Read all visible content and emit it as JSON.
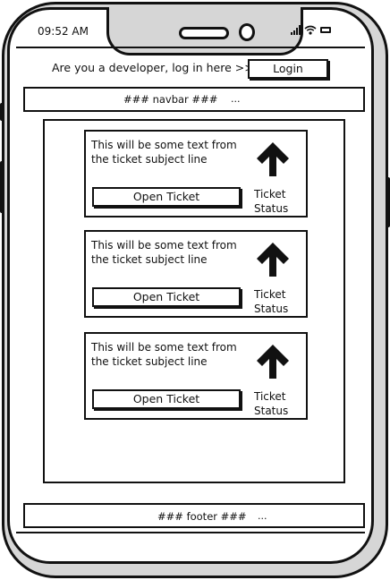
{
  "status_bar": {
    "time": "09:52 AM",
    "icons": [
      "signal-icon",
      "wifi-icon",
      "battery-icon"
    ]
  },
  "developer_bar": {
    "prompt": "Are you a developer, log in here >>",
    "login_label": "Login"
  },
  "navbar": {
    "label": "### navbar ###",
    "ellipsis": "..."
  },
  "tickets": [
    {
      "subject": "This will be some text from the ticket subject line",
      "open_label": "Open Ticket",
      "status_label": "Ticket Status",
      "status_icon": "arrow-up-icon"
    },
    {
      "subject": "This will be some text from the ticket subject line",
      "open_label": "Open Ticket",
      "status_label": "Ticket Status",
      "status_icon": "arrow-up-icon"
    },
    {
      "subject": "This will be some text from the ticket subject line",
      "open_label": "Open Ticket",
      "status_label": "Ticket Status",
      "status_icon": "arrow-up-icon"
    }
  ],
  "footer": {
    "label": "### footer ###",
    "ellipsis": "..."
  }
}
